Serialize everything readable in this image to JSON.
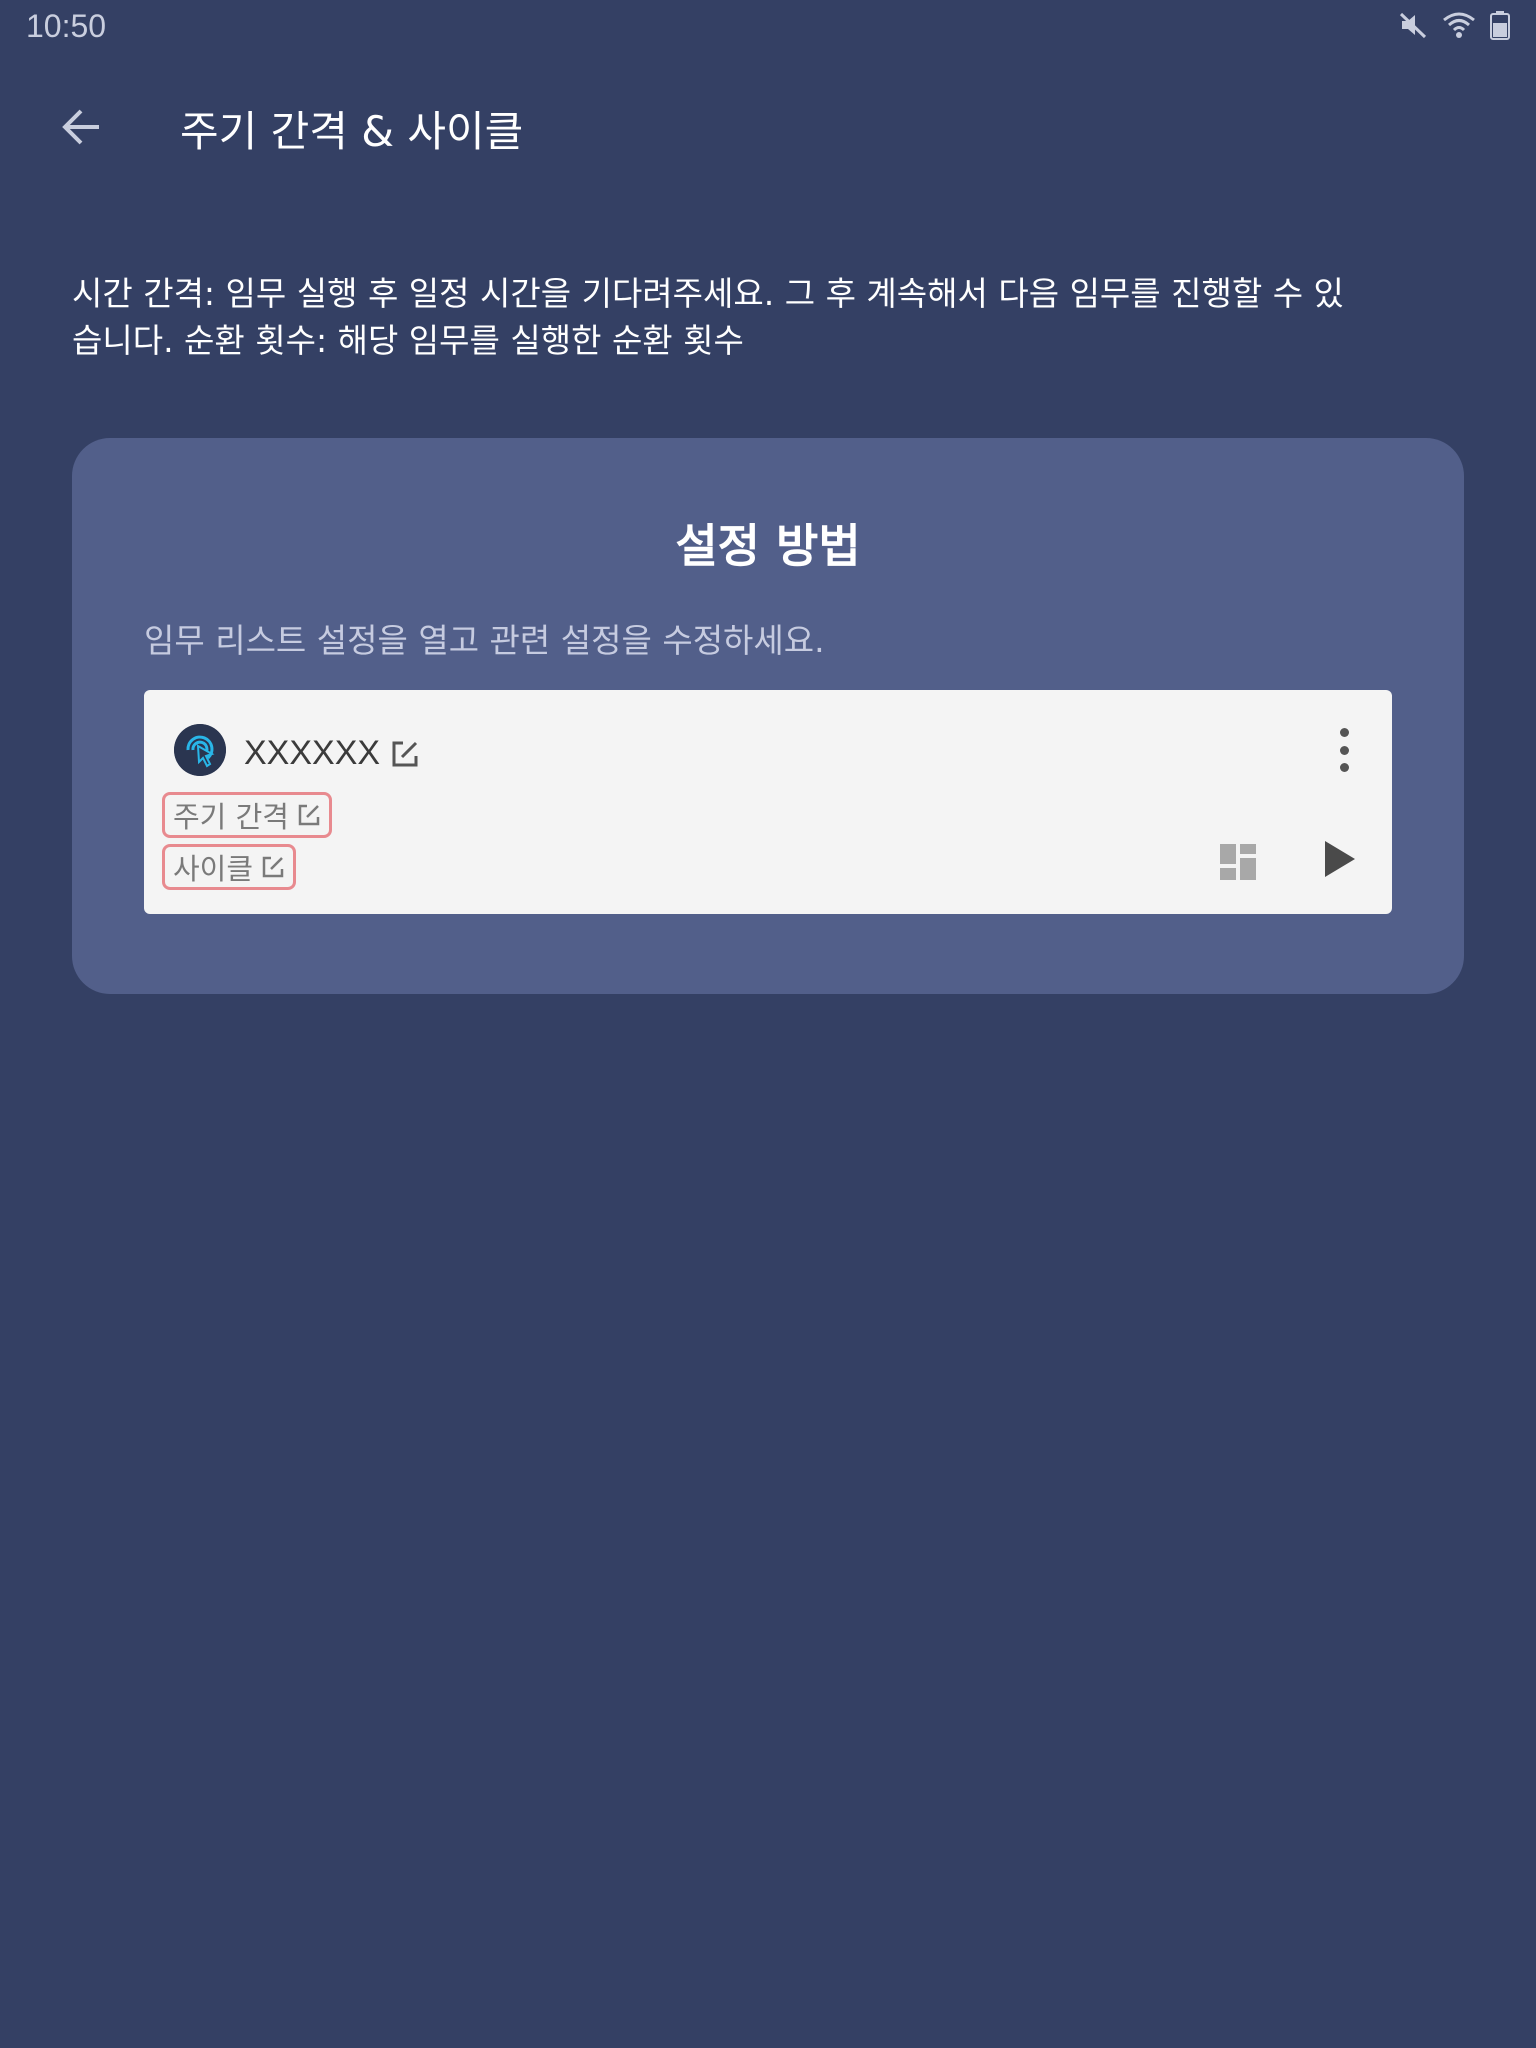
{
  "status_bar": {
    "time": "10:50",
    "icons": [
      "mute-icon",
      "wifi-icon",
      "battery-icon"
    ]
  },
  "app_bar": {
    "back_icon": "arrow-back-icon",
    "title": "주기 간격 & 사이클"
  },
  "description": "시간 간격: 임무 실행 후 일정 시간을 기다려주세요. 그 후 계속해서 다음 임무를 진행할 수 있습니다. 순환 횟수: 해당 임무를 실행한 순환 횟수",
  "guide": {
    "title": "설정 방법",
    "subtitle": "임무 리스트 설정을 열고 관련 설정을 수정하세요.",
    "task": {
      "name": "XXXXXX",
      "interval_label": "주기 간격",
      "cycle_label": "사이클",
      "icons": [
        "app-logo-icon",
        "edit-icon",
        "more-vert-icon",
        "widget-icon",
        "play-icon"
      ]
    }
  },
  "colors": {
    "background": "#344064",
    "card": "#525f8a",
    "task_item": "#f4f4f4",
    "highlight": "#e88a8f"
  }
}
